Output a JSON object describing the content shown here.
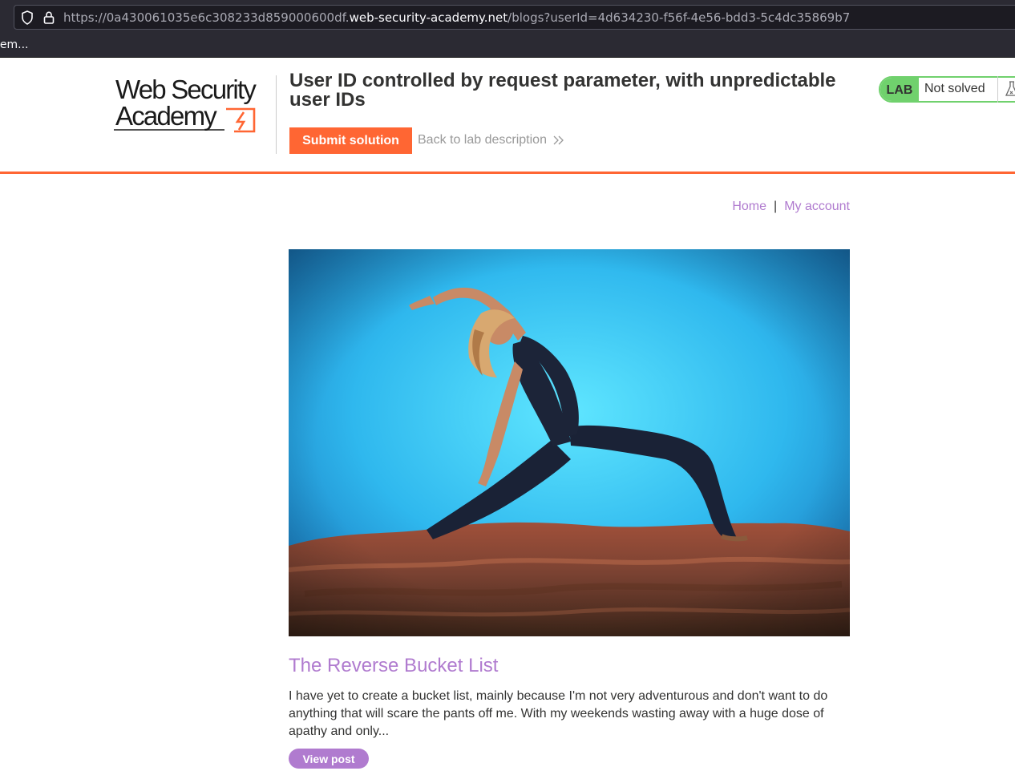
{
  "browser": {
    "url_prefix": "https://0a430061035e6c308233d859000600df.",
    "url_host": "web-security-academy.net",
    "url_path": "/blogs?userId=4d634230-f56f-4e56-bdd3-5c4dc35869b7",
    "bookmark": "lem..."
  },
  "header": {
    "logo_line1": "Web Security",
    "logo_line2": "Academy",
    "lab_title": "User ID controlled by request parameter, with unpredictable user IDs",
    "submit_label": "Submit solution",
    "back_label": "Back to lab description",
    "lab_badge": "LAB",
    "lab_status": "Not solved"
  },
  "nav": {
    "home": "Home",
    "separator": "|",
    "my_account": "My account"
  },
  "post": {
    "title": "The Reverse Bucket List",
    "summary": "I have yet to create a bucket list, mainly because I'm not very adventurous and don't want to do anything that will scare the pants off me. With my weekends wasting away with a huge dose of apathy and only...",
    "view_label": "View post"
  },
  "colors": {
    "accent_orange": "#ff6633",
    "link_purple": "#b07bcf",
    "lab_green": "#70d16d"
  }
}
